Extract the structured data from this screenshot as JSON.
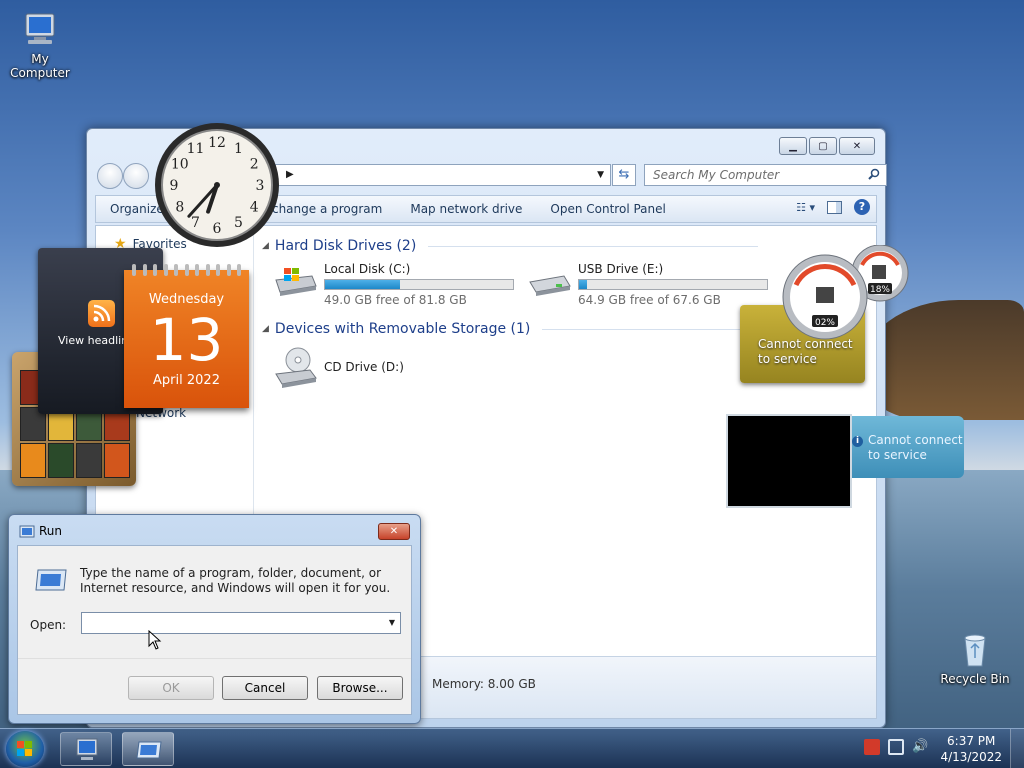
{
  "desktop": {
    "icons": [
      {
        "label": "My Computer"
      },
      {
        "label": "Recycle Bin"
      }
    ]
  },
  "explorer": {
    "search_placeholder": "Search My Computer",
    "toolbar": {
      "organize": "Organize",
      "uninstall": "Uninstall or change a program",
      "map_drive": "Map network drive",
      "control_panel": "Open Control Panel"
    },
    "nav": {
      "favorites": "Favorites",
      "network": "Network"
    },
    "groups": {
      "hard_disk": "Hard Disk Drives (2)",
      "removable": "Devices with Removable Storage (1)"
    },
    "drives": [
      {
        "name": "Local Disk (C:)",
        "free": "49.0 GB free of 81.8 GB",
        "used_fraction": 0.4
      },
      {
        "name": "USB Drive (E:)",
        "free": "64.9 GB free of 67.6 GB",
        "used_fraction": 0.04
      },
      {
        "name": "CD Drive (D:)"
      }
    ],
    "details": {
      "memory": "Memory: 8.00 GB"
    }
  },
  "gadgets": {
    "feed": {
      "text": "View headlines"
    },
    "calendar": {
      "weekday": "Wednesday",
      "day": "13",
      "month_year": "April 2022"
    },
    "clock": {
      "hour": 6,
      "minute": 37
    },
    "meter": {
      "cpu": "02%",
      "mem": "18%",
      "message": "Cannot connect to service"
    },
    "weather": {
      "message": "Cannot connect to service"
    }
  },
  "run_dialog": {
    "title": "Run",
    "description": "Type the name of a program, folder, document, or Internet resource, and Windows will open it for you.",
    "open_label": "Open:",
    "open_value": "",
    "ok": "OK",
    "cancel": "Cancel",
    "browse": "Browse..."
  },
  "taskbar": {
    "time": "6:37 PM",
    "date": "4/13/2022"
  }
}
